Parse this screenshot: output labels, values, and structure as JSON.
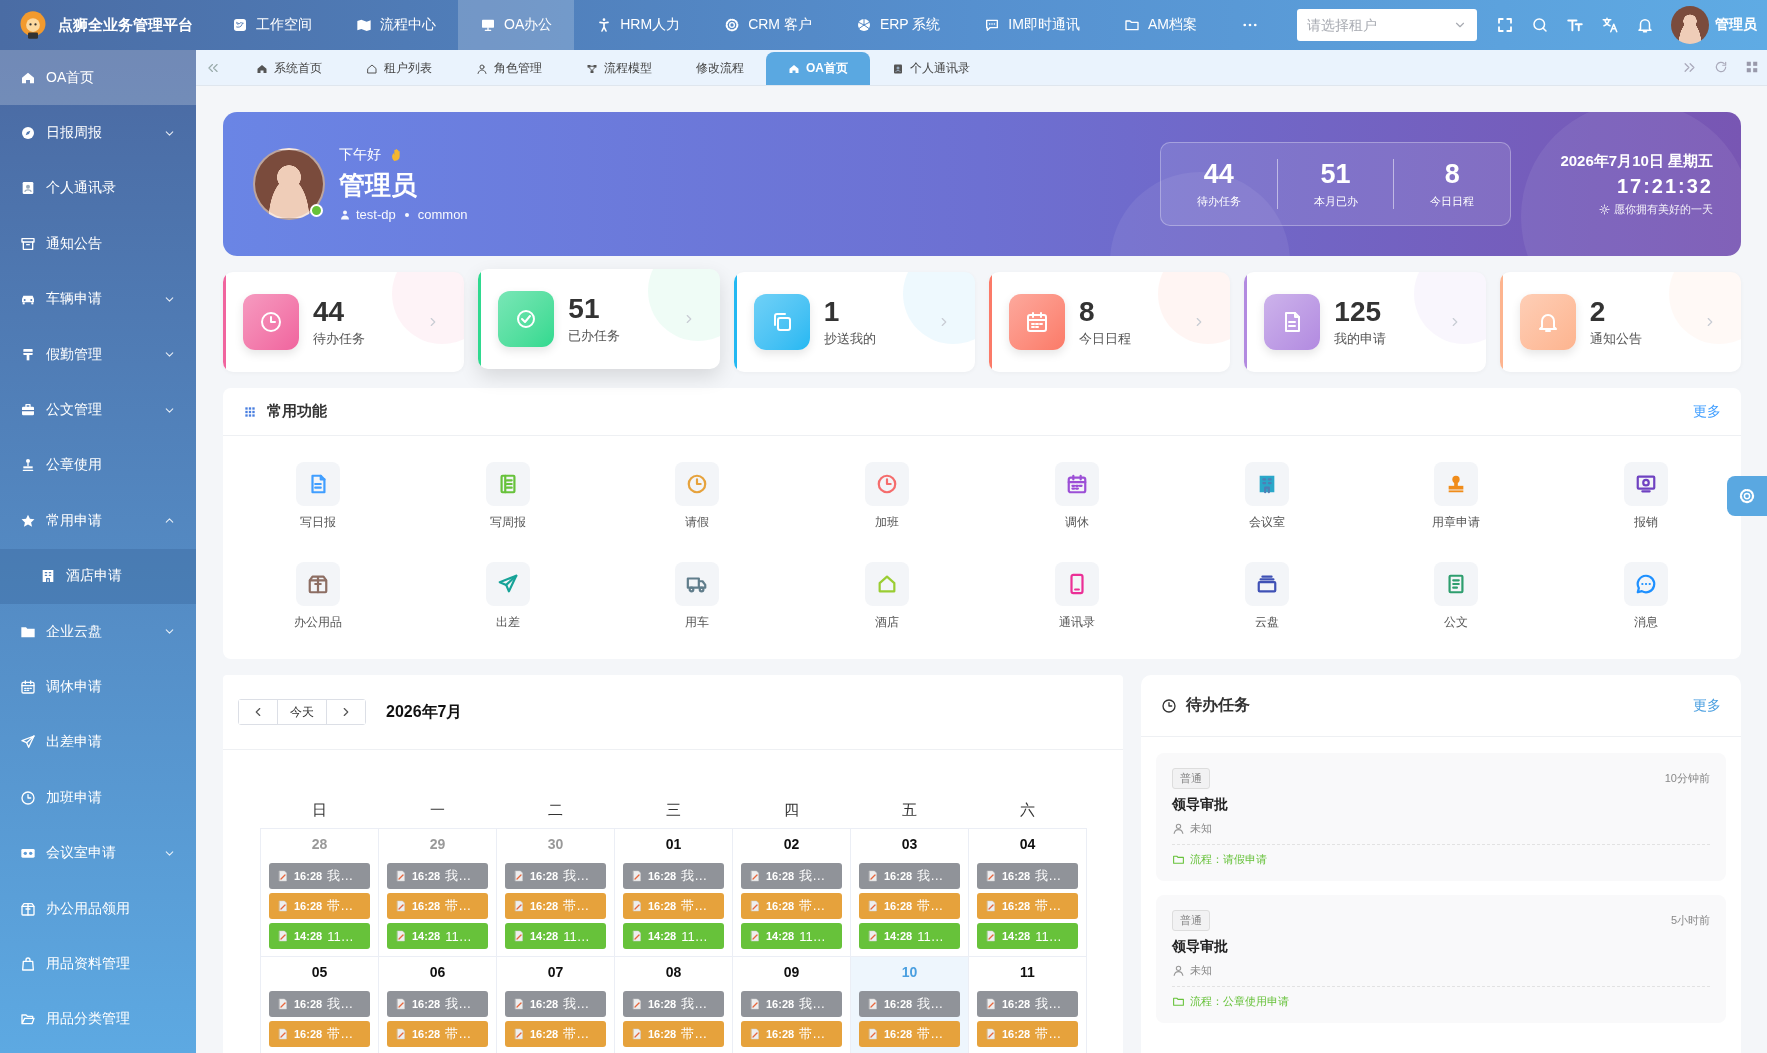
{
  "app": {
    "title": "点狮全业务管理平台"
  },
  "top_nav": [
    {
      "label": "工作空间",
      "selected": false
    },
    {
      "label": "流程中心",
      "selected": false
    },
    {
      "label": "OA办公",
      "selected": true
    },
    {
      "label": "HRM人力",
      "selected": false
    },
    {
      "label": "CRM 客户",
      "selected": false
    },
    {
      "label": "ERP 系统",
      "selected": false
    },
    {
      "label": "IM即时通讯",
      "selected": false
    },
    {
      "label": "AM档案",
      "selected": false
    }
  ],
  "tenant_select": {
    "placeholder": "请选择租户"
  },
  "user": {
    "name": "管理员"
  },
  "sidebar": {
    "items": [
      {
        "label": "OA首页",
        "selected": true
      },
      {
        "label": "日报周报",
        "selected": false,
        "expanded": false
      },
      {
        "label": "个人通讯录",
        "selected": false
      },
      {
        "label": "通知公告",
        "selected": false
      },
      {
        "label": "车辆申请",
        "selected": false,
        "expanded": false
      },
      {
        "label": "假勤管理",
        "selected": false,
        "expanded": false
      },
      {
        "label": "公文管理",
        "selected": false,
        "expanded": false
      },
      {
        "label": "公章使用",
        "selected": false
      },
      {
        "label": "常用申请",
        "selected": false,
        "expanded": true,
        "children": [
          {
            "label": "酒店申请",
            "selected": false
          }
        ]
      },
      {
        "label": "企业云盘",
        "selected": false,
        "expanded": false
      },
      {
        "label": "调休申请",
        "selected": false
      },
      {
        "label": "出差申请",
        "selected": false
      },
      {
        "label": "加班申请",
        "selected": false
      },
      {
        "label": "会议室申请",
        "selected": false,
        "expanded": false
      },
      {
        "label": "办公用品领用",
        "selected": false
      },
      {
        "label": "用品资料管理",
        "selected": false
      },
      {
        "label": "用品分类管理",
        "selected": false
      }
    ]
  },
  "tabs": [
    {
      "label": "系统首页",
      "selected": false
    },
    {
      "label": "租户列表",
      "selected": false
    },
    {
      "label": "角色管理",
      "selected": false
    },
    {
      "label": "流程模型",
      "selected": false
    },
    {
      "label": "修改流程",
      "selected": false
    },
    {
      "label": "OA首页",
      "selected": true
    },
    {
      "label": "个人通讯录",
      "selected": false
    }
  ],
  "hero": {
    "greeting": "下午好",
    "name": "管理员",
    "dept": "test-dp",
    "role": "common",
    "online": true,
    "stats": [
      {
        "value": "44",
        "label": "待办任务"
      },
      {
        "value": "51",
        "label": "本月已办"
      },
      {
        "value": "8",
        "label": "今日日程"
      }
    ],
    "date": "2026年7月10日 星期五",
    "time": "17:21:32",
    "wish": "愿你拥有美好的一天"
  },
  "stat_cards": [
    {
      "value": "44",
      "label": "待办任务",
      "color": "#f0649e",
      "hovered": false
    },
    {
      "value": "51",
      "label": "已办任务",
      "color": "#2fd98f",
      "hovered": true
    },
    {
      "value": "1",
      "label": "抄送我的",
      "color": "#22b8f2",
      "hovered": false
    },
    {
      "value": "8",
      "label": "今日日程",
      "color": "#fb7a68",
      "hovered": false
    },
    {
      "value": "125",
      "label": "我的申请",
      "color": "#b28ae0",
      "hovered": false
    },
    {
      "value": "2",
      "label": "通知公告",
      "color": "#fdb48f",
      "hovered": false
    }
  ],
  "functions": {
    "title": "常用功能",
    "more": "更多",
    "items": [
      {
        "label": "写日报",
        "color": "#409eff"
      },
      {
        "label": "写周报",
        "color": "#67c23a"
      },
      {
        "label": "请假",
        "color": "#e6a23c"
      },
      {
        "label": "加班",
        "color": "#f56c6c"
      },
      {
        "label": "调休",
        "color": "#9c4fd6"
      },
      {
        "label": "会议室",
        "color": "#2aa7c9"
      },
      {
        "label": "用章申请",
        "color": "#f08c1a"
      },
      {
        "label": "报销",
        "color": "#6f42c1"
      },
      {
        "label": "办公用品",
        "color": "#8d6e63"
      },
      {
        "label": "出差",
        "color": "#17a398"
      },
      {
        "label": "用车",
        "color": "#607d8b"
      },
      {
        "label": "酒店",
        "color": "#9acd32"
      },
      {
        "label": "通讯录",
        "color": "#eb2f96"
      },
      {
        "label": "云盘",
        "color": "#3f51b5"
      },
      {
        "label": "公文",
        "color": "#2e9e6e"
      },
      {
        "label": "消息",
        "color": "#1e90ff"
      }
    ]
  },
  "calendar": {
    "today_button": "今天",
    "title": "2026年7月",
    "weekdays": [
      "日",
      "一",
      "二",
      "三",
      "四",
      "五",
      "六"
    ],
    "weeks": [
      {
        "days": [
          {
            "day": "28",
            "other_month": true,
            "today": false,
            "events": [
              {
                "time": "16:28",
                "text": "我…",
                "color": "#909399"
              },
              {
                "time": "16:28",
                "text": "带…",
                "color": "#e6a23c"
              },
              {
                "time": "14:28",
                "text": "11…",
                "color": "#67c23a"
              }
            ]
          },
          {
            "day": "29",
            "other_month": true,
            "today": false,
            "events": [
              {
                "time": "16:28",
                "text": "我…",
                "color": "#909399"
              },
              {
                "time": "16:28",
                "text": "带…",
                "color": "#e6a23c"
              },
              {
                "time": "14:28",
                "text": "11…",
                "color": "#67c23a"
              }
            ]
          },
          {
            "day": "30",
            "other_month": true,
            "today": false,
            "events": [
              {
                "time": "16:28",
                "text": "我…",
                "color": "#909399"
              },
              {
                "time": "16:28",
                "text": "带…",
                "color": "#e6a23c"
              },
              {
                "time": "14:28",
                "text": "11…",
                "color": "#67c23a"
              }
            ]
          },
          {
            "day": "01",
            "other_month": false,
            "today": false,
            "events": [
              {
                "time": "16:28",
                "text": "我…",
                "color": "#909399"
              },
              {
                "time": "16:28",
                "text": "带…",
                "color": "#e6a23c"
              },
              {
                "time": "14:28",
                "text": "11…",
                "color": "#67c23a"
              }
            ]
          },
          {
            "day": "02",
            "other_month": false,
            "today": false,
            "events": [
              {
                "time": "16:28",
                "text": "我…",
                "color": "#909399"
              },
              {
                "time": "16:28",
                "text": "带…",
                "color": "#e6a23c"
              },
              {
                "time": "14:28",
                "text": "11…",
                "color": "#67c23a"
              }
            ]
          },
          {
            "day": "03",
            "other_month": false,
            "today": false,
            "events": [
              {
                "time": "16:28",
                "text": "我…",
                "color": "#909399"
              },
              {
                "time": "16:28",
                "text": "带…",
                "color": "#e6a23c"
              },
              {
                "time": "14:28",
                "text": "11…",
                "color": "#67c23a"
              }
            ]
          },
          {
            "day": "04",
            "other_month": false,
            "today": false,
            "events": [
              {
                "time": "16:28",
                "text": "我…",
                "color": "#909399"
              },
              {
                "time": "16:28",
                "text": "带…",
                "color": "#e6a23c"
              },
              {
                "time": "14:28",
                "text": "11…",
                "color": "#67c23a"
              }
            ]
          }
        ]
      },
      {
        "days": [
          {
            "day": "05",
            "other_month": false,
            "today": false,
            "events": [
              {
                "time": "16:28",
                "text": "我…",
                "color": "#909399"
              },
              {
                "time": "16:28",
                "text": "带…",
                "color": "#e6a23c"
              }
            ]
          },
          {
            "day": "06",
            "other_month": false,
            "today": false,
            "events": [
              {
                "time": "16:28",
                "text": "我…",
                "color": "#909399"
              },
              {
                "time": "16:28",
                "text": "带…",
                "color": "#e6a23c"
              }
            ]
          },
          {
            "day": "07",
            "other_month": false,
            "today": false,
            "events": [
              {
                "time": "16:28",
                "text": "我…",
                "color": "#909399"
              },
              {
                "time": "16:28",
                "text": "带…",
                "color": "#e6a23c"
              }
            ]
          },
          {
            "day": "08",
            "other_month": false,
            "today": false,
            "events": [
              {
                "time": "16:28",
                "text": "我…",
                "color": "#909399"
              },
              {
                "time": "16:28",
                "text": "带…",
                "color": "#e6a23c"
              }
            ]
          },
          {
            "day": "09",
            "other_month": false,
            "today": false,
            "events": [
              {
                "time": "16:28",
                "text": "我…",
                "color": "#909399"
              },
              {
                "time": "16:28",
                "text": "带…",
                "color": "#e6a23c"
              }
            ]
          },
          {
            "day": "10",
            "other_month": false,
            "today": true,
            "events": [
              {
                "time": "16:28",
                "text": "我…",
                "color": "#909399"
              },
              {
                "time": "16:28",
                "text": "带…",
                "color": "#e6a23c"
              }
            ]
          },
          {
            "day": "11",
            "other_month": false,
            "today": false,
            "events": [
              {
                "time": "16:28",
                "text": "我…",
                "color": "#909399"
              },
              {
                "time": "16:28",
                "text": "带…",
                "color": "#e6a23c"
              }
            ]
          }
        ]
      }
    ]
  },
  "todo": {
    "title": "待办任务",
    "more": "更多",
    "items": [
      {
        "tag": "普通",
        "time": "10分钟前",
        "title": "领导审批",
        "person": "未知",
        "flow": "流程：请假申请"
      },
      {
        "tag": "普通",
        "time": "5小时前",
        "title": "领导审批",
        "person": "未知",
        "flow": "流程：公章使用申请"
      }
    ]
  }
}
